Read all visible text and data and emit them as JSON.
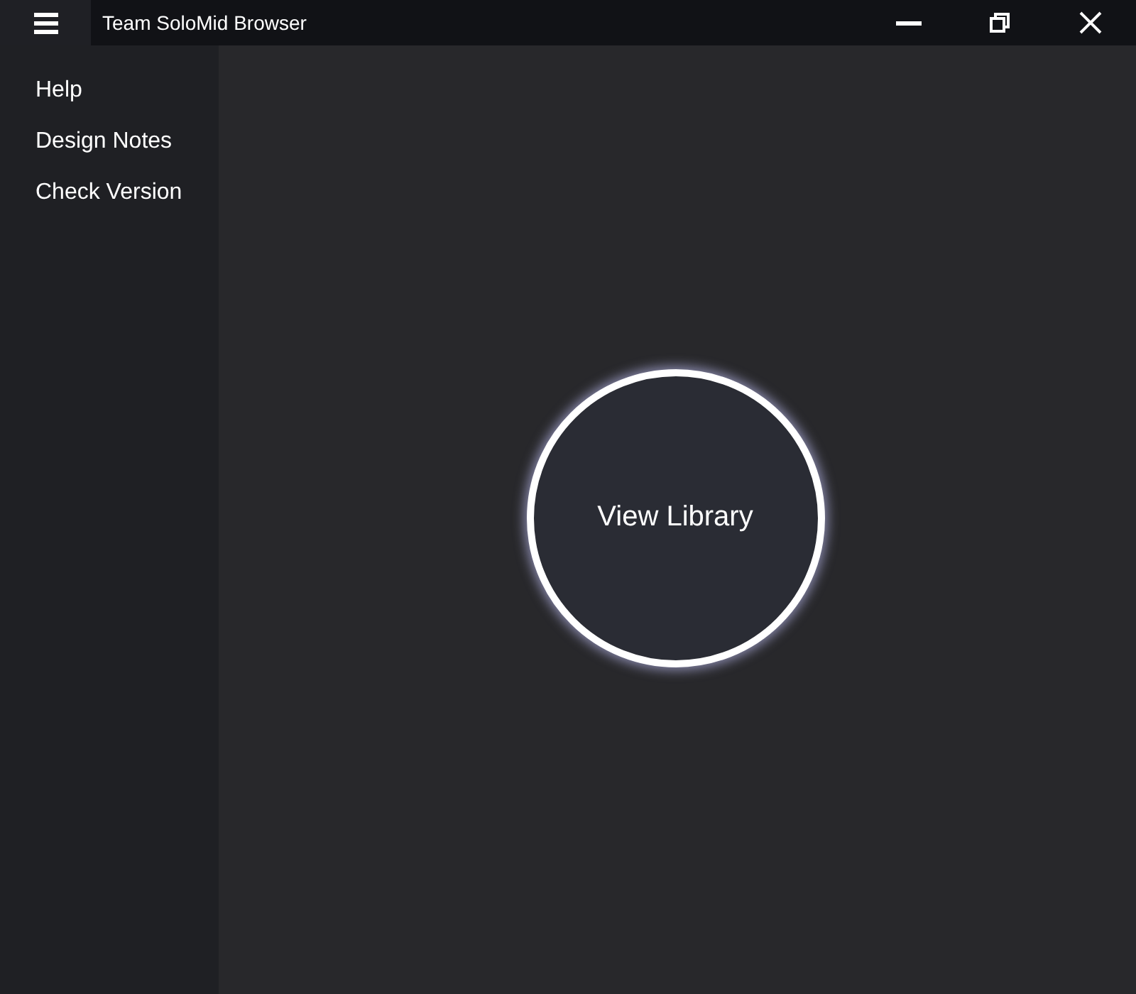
{
  "window": {
    "title": "Team SoloMid Browser"
  },
  "sidebar": {
    "items": [
      {
        "label": "Help"
      },
      {
        "label": "Design Notes"
      },
      {
        "label": "Check Version"
      }
    ]
  },
  "main": {
    "button": "View Library"
  }
}
